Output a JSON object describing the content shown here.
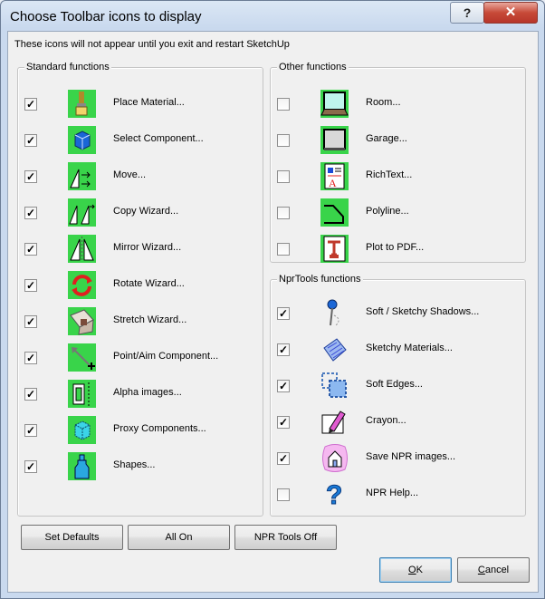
{
  "window": {
    "title": "Choose Toolbar icons to display",
    "help_glyph": "?",
    "close_glyph": "✕"
  },
  "notice": "These icons will not appear until you exit and restart SketchUp",
  "standard": {
    "title": "Standard functions",
    "items": [
      {
        "label": "Place Material...",
        "checked": true,
        "icon": "paint-brush-icon"
      },
      {
        "label": "Select Component...",
        "checked": true,
        "icon": "component-cube-icon"
      },
      {
        "label": "Move...",
        "checked": true,
        "icon": "move-icon"
      },
      {
        "label": "Copy Wizard...",
        "checked": true,
        "icon": "copy-wizard-icon"
      },
      {
        "label": "Mirror Wizard...",
        "checked": true,
        "icon": "mirror-wizard-icon"
      },
      {
        "label": "Rotate Wizard...",
        "checked": true,
        "icon": "rotate-wizard-icon"
      },
      {
        "label": "Stretch Wizard...",
        "checked": true,
        "icon": "stretch-wizard-icon"
      },
      {
        "label": "Point/Aim Component...",
        "checked": true,
        "icon": "point-aim-icon"
      },
      {
        "label": "Alpha images...",
        "checked": true,
        "icon": "alpha-images-icon"
      },
      {
        "label": "Proxy Components...",
        "checked": true,
        "icon": "proxy-components-icon"
      },
      {
        "label": "Shapes...",
        "checked": true,
        "icon": "shapes-bottle-icon"
      }
    ]
  },
  "other": {
    "title": "Other functions",
    "items": [
      {
        "label": "Room...",
        "checked": false,
        "icon": "room-icon"
      },
      {
        "label": "Garage...",
        "checked": false,
        "icon": "garage-icon"
      },
      {
        "label": "RichText...",
        "checked": false,
        "icon": "richtext-icon"
      },
      {
        "label": "Polyline...",
        "checked": false,
        "icon": "polyline-icon"
      },
      {
        "label": "Plot to PDF...",
        "checked": false,
        "icon": "plot-pdf-icon"
      }
    ]
  },
  "npr": {
    "title": "NprTools functions",
    "items": [
      {
        "label": "Soft / Sketchy Shadows...",
        "checked": true,
        "icon": "pin-shadow-icon"
      },
      {
        "label": "Sketchy Materials...",
        "checked": true,
        "icon": "sketchy-materials-icon"
      },
      {
        "label": "Soft Edges...",
        "checked": true,
        "icon": "soft-edges-icon"
      },
      {
        "label": "Crayon...",
        "checked": true,
        "icon": "crayon-icon"
      },
      {
        "label": "Save NPR images...",
        "checked": true,
        "icon": "save-npr-house-icon"
      },
      {
        "label": "NPR Help...",
        "checked": false,
        "icon": "help-question-icon"
      }
    ]
  },
  "buttons": {
    "set_defaults": "Set Defaults",
    "all_on": "All On",
    "npr_off": "NPR Tools Off",
    "ok_u": "O",
    "ok_rest": "K",
    "cancel_u": "C",
    "cancel_rest": "ancel"
  },
  "check_glyph": "✓"
}
